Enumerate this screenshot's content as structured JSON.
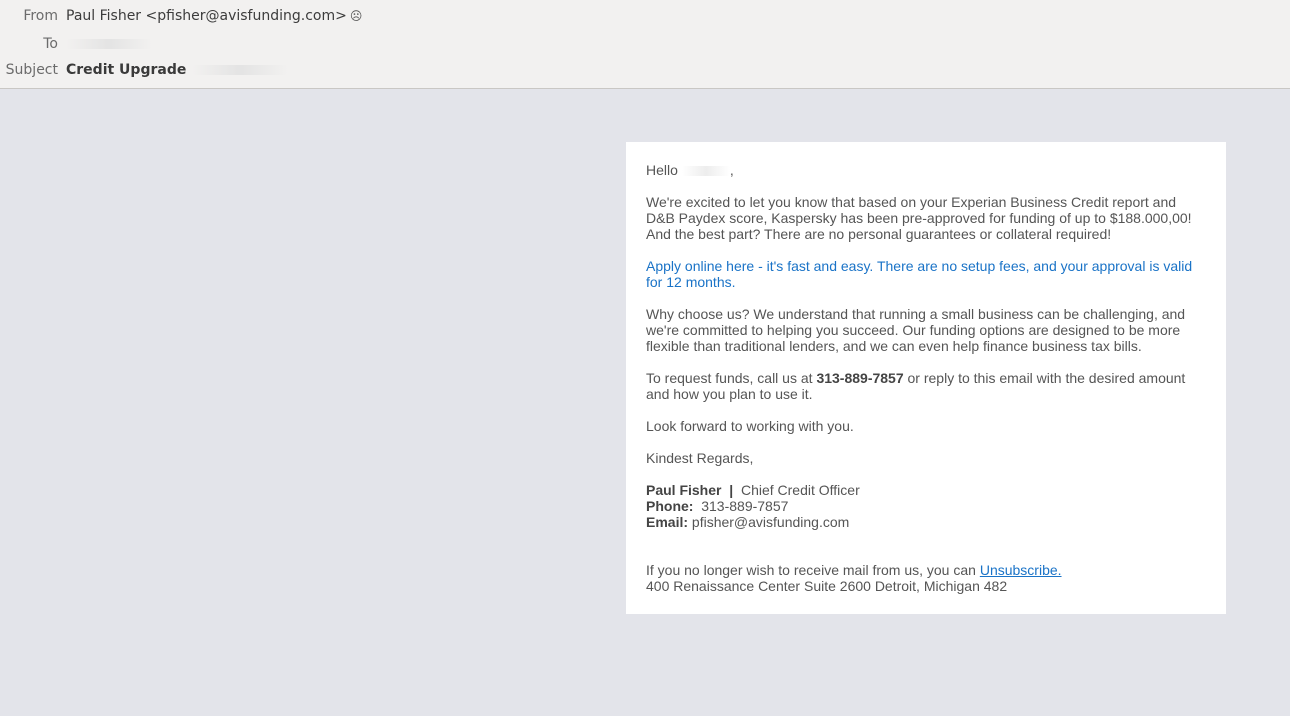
{
  "header": {
    "from_label": "From",
    "from_value": "Paul Fisher <pfisher@avisfunding.com>",
    "from_icon": "contact-icon",
    "to_label": "To",
    "subject_label": "Subject",
    "subject_value": "Credit Upgrade"
  },
  "email": {
    "greeting": "Hello",
    "greeting_suffix": ",",
    "paragraph1": "We're excited to let you know that based on your Experian Business Credit report and D&B Paydex score, Kaspersky has been pre-approved for funding of up to $188.000,00! And the best part? There are no personal guarantees or collateral required!",
    "apply_link": "Apply online here - it's fast and easy. There are no setup fees, and your approval is valid for 12 months.",
    "paragraph3": "Why choose us? We understand that running a small business can be challenging, and we're committed to helping you succeed. Our funding options are designed to be more flexible than traditional lenders, and we can even help finance business tax bills.",
    "request_prefix": "To request funds, call us at ",
    "request_phone": "313-889-7857",
    "request_suffix": " or reply to this email with the desired amount and how you plan to use it.",
    "look_forward": "Look forward to working with you.",
    "closing": "Kindest Regards,",
    "signature": {
      "name": "Paul Fisher",
      "separator": "|",
      "title": "Chief Credit Officer",
      "phone_label": "Phone:",
      "phone_value": "313-889-7857",
      "email_label": "Email:",
      "email_value": "pfisher@avisfunding.com"
    },
    "unsubscribe_prefix": "If you no longer wish to receive mail from us, you can ",
    "unsubscribe_link": "Unsubscribe.",
    "address": "400 Renaissance Center Suite 2600 Detroit, Michigan 482"
  },
  "colors": {
    "background": "#e3e4ea",
    "header_bg": "#f2f1f0",
    "link": "#1a73c7",
    "body_text": "#555555"
  }
}
